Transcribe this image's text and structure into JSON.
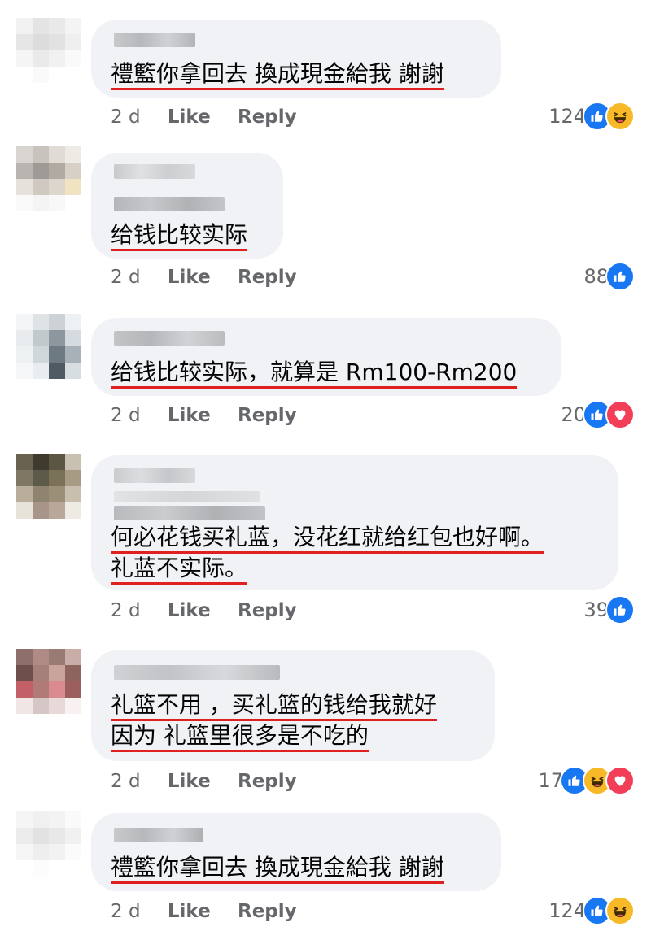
{
  "comments": [
    {
      "lines": [
        "禮籃你拿回去 換成現金給我 謝謝"
      ],
      "time": "2 d",
      "like": "Like",
      "reply": "Reply",
      "count": "124",
      "reactions": [
        "like-icon",
        "haha-icon"
      ]
    },
    {
      "lines": [
        "给钱比较实际"
      ],
      "time": "2 d",
      "like": "Like",
      "reply": "Reply",
      "count": "88",
      "reactions": [
        "like-icon"
      ]
    },
    {
      "lines": [
        "给钱比较实际，就算是 Rm100-Rm200"
      ],
      "time": "2 d",
      "like": "Like",
      "reply": "Reply",
      "count": "20",
      "reactions": [
        "like-icon",
        "love-icon"
      ]
    },
    {
      "lines": [
        "何必花钱买礼蓝，没花红就给红包也好啊。",
        "礼蓝不实际。"
      ],
      "time": "2 d",
      "like": "Like",
      "reply": "Reply",
      "count": "39",
      "reactions": [
        "like-icon"
      ]
    },
    {
      "lines": [
        "礼篮不用 ，买礼篮的钱给我就好",
        "因为 礼篮里很多是不吃的"
      ],
      "time": "2 d",
      "like": "Like",
      "reply": "Reply",
      "count": "17",
      "reactions": [
        "like-icon",
        "haha-icon",
        "love-icon"
      ]
    },
    {
      "lines": [
        "禮籃你拿回去 換成現金給我 謝謝"
      ],
      "time": "2 d",
      "like": "Like",
      "reply": "Reply",
      "count": "124",
      "reactions": [
        "like-icon",
        "haha-icon"
      ]
    }
  ],
  "colors": {
    "bubble": "#f0f2f5",
    "underline": "#e02020",
    "meta": "#65676b",
    "like": "#1877f2",
    "love": "#f33e58",
    "haha": "#f7b928"
  }
}
